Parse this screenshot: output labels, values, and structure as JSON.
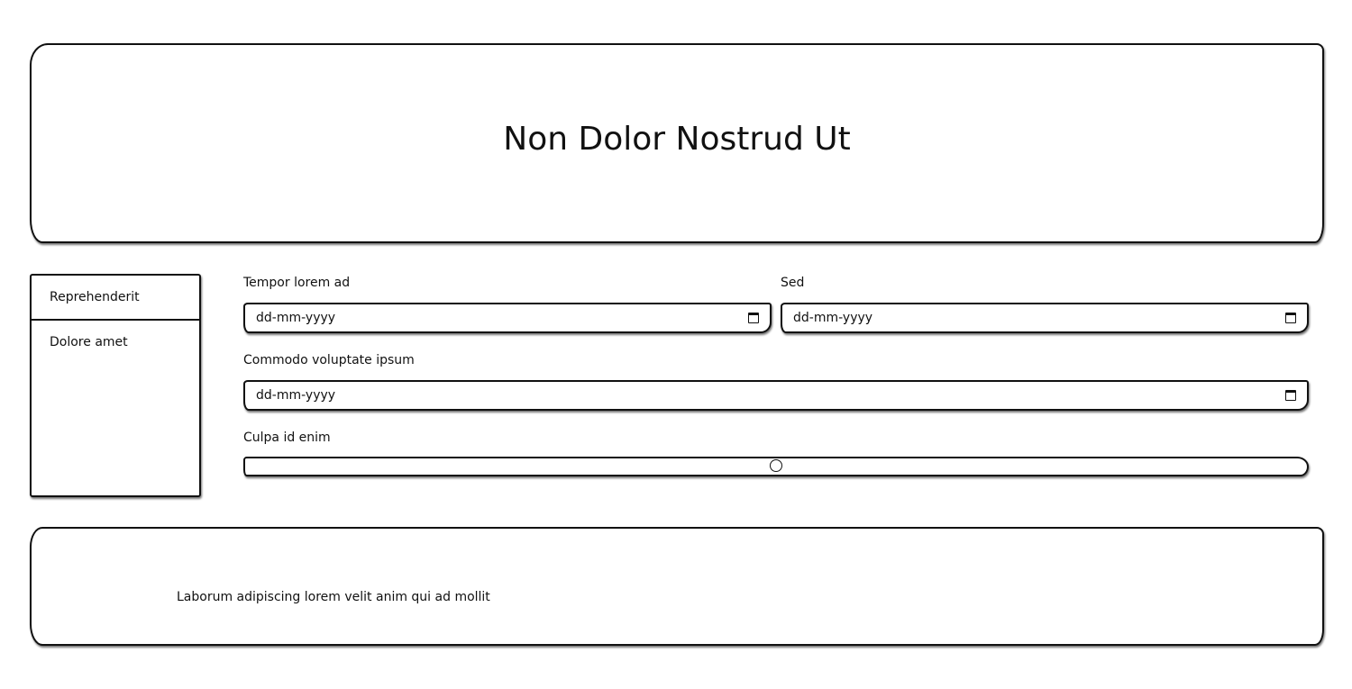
{
  "header": {
    "title": "Non Dolor Nostrud Ut"
  },
  "sidebar": {
    "items": [
      {
        "label": "Reprehenderit"
      },
      {
        "label": "Dolore amet"
      }
    ]
  },
  "form": {
    "field1": {
      "label": "Tempor lorem ad",
      "placeholder": "dd-mm-yyyy",
      "icon": "calendar-icon"
    },
    "field2": {
      "label": "Sed",
      "placeholder": "dd-mm-yyyy",
      "icon": "calendar-icon"
    },
    "field3": {
      "label": "Commodo voluptate ipsum",
      "placeholder": "dd-mm-yyyy",
      "icon": "calendar-icon"
    },
    "slider": {
      "label": "Culpa id enim",
      "value": 0.5
    }
  },
  "footer": {
    "text": "Laborum adipiscing lorem velit anim qui ad mollit"
  }
}
